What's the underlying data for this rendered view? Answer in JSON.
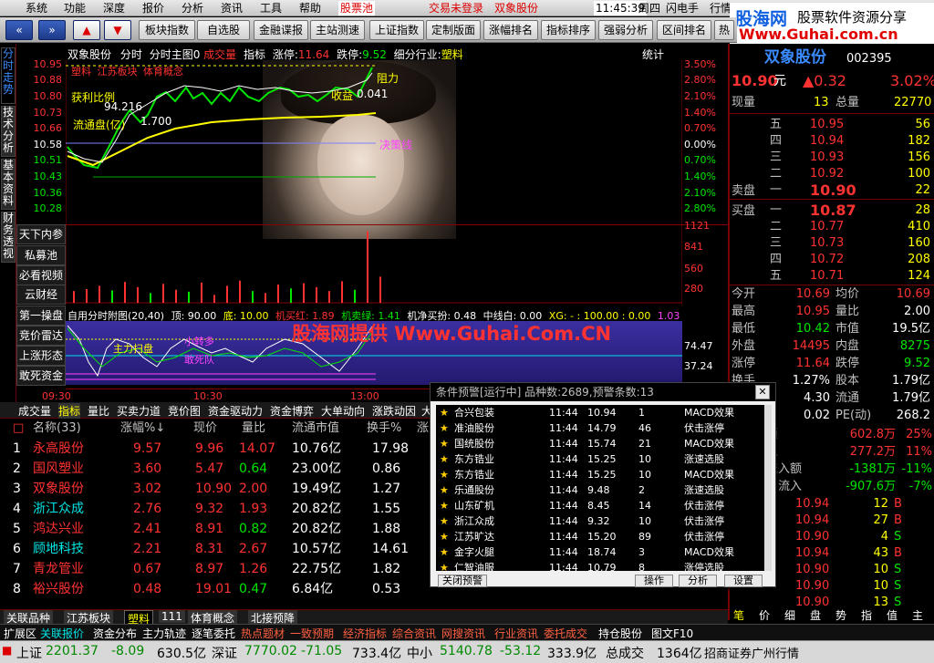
{
  "menu": {
    "items": [
      "系统",
      "功能",
      "深度",
      "报价",
      "分析",
      "资讯",
      "工具",
      "帮助",
      "股票池"
    ],
    "login_status": "交易未登录",
    "stock_name": "双象股份",
    "time": "11:45:39",
    "weekday": "周四",
    "flash": "闪电手",
    "hq": "行情"
  },
  "watermark_top": {
    "site": "股海网",
    "slogan": "股票软件资源分享",
    "url": "Www.Guhai.com.cn"
  },
  "toolbar": {
    "buttons": [
      "板块指数",
      "自选股",
      "金融谍报",
      "主站测速",
      "上证指数",
      "定制版面",
      "涨幅排名",
      "指标排序",
      "强弱分析",
      "区间排名",
      "热"
    ]
  },
  "vtabs": [
    "分时走势",
    "技术分析",
    "基本资料",
    "财务透视"
  ],
  "chart": {
    "header": {
      "stock": "双象股份",
      "mode": "分时",
      "main_label": "分时主图0",
      "main_tag": "成交量",
      "indicator": "指标",
      "stop_up_label": "涨停:",
      "stop_up": "11.64",
      "stop_down_label": "跌停:",
      "stop_down": "9.52",
      "industry_label": "细分行业:",
      "industry": "塑料",
      "stats": "统计"
    },
    "legend": [
      "塑料",
      "江苏板块",
      "体育概念"
    ],
    "annotations": {
      "profit_ratio": "获利比例",
      "profit_val": "94.216",
      "float_cap": "流通盘(亿)",
      "float_val": "1.700",
      "income": "收益",
      "income_val": "0.041",
      "resist": "阻力",
      "decision": "决策线"
    },
    "price_axis": [
      "10.95",
      "10.88",
      "10.80",
      "10.73",
      "10.66",
      "10.58",
      "10.51",
      "10.43",
      "10.36",
      "10.28"
    ],
    "pct_axis": [
      "3.50%",
      "2.80%",
      "2.10%",
      "1.40%",
      "0.70%",
      "0.00%",
      "0.70%",
      "1.40%",
      "2.10%",
      "2.80%"
    ],
    "vol_axis": [
      "1121",
      "841",
      "560",
      "280"
    ],
    "side_buttons": [
      "天下内参",
      "私募池",
      "必看视频",
      "云财经",
      "第一操盘",
      "竞价雷达",
      "上涨形态",
      "敢死资金"
    ],
    "sub_header": {
      "title": "自用分时附图(20,40)",
      "top": "顶: 90.00",
      "bottom": "底: 10.00",
      "red_label": "机买红: 1.89",
      "green_label": "机卖绿: 1.41",
      "net": "机净买扮: 0.48",
      "mid": "中线白: 0.00",
      "xg": "XG: - : 100.00 : 0.00",
      "tail": "1.03"
    },
    "sub_axis": [
      "74.47",
      "37.24"
    ],
    "sub_labels": {
      "main_force": "主力扫盘",
      "kong": "小转多",
      "dead": "敢死队"
    },
    "guhai_banner": "股海网提供 Www.Guhai.Com.CN",
    "time_axis": [
      "09:30",
      "10:30",
      "13:00"
    ],
    "volume_bars": [
      {
        "v": 180,
        "c": "r"
      },
      {
        "v": 210,
        "c": "r"
      },
      {
        "v": 260,
        "c": "r"
      },
      {
        "v": 190,
        "c": "g"
      },
      {
        "v": 320,
        "c": "r"
      },
      {
        "v": 240,
        "c": "r"
      },
      {
        "v": 150,
        "c": "g"
      },
      {
        "v": 290,
        "c": "r"
      },
      {
        "v": 200,
        "c": "r"
      },
      {
        "v": 170,
        "c": "g"
      },
      {
        "v": 310,
        "c": "r"
      },
      {
        "v": 120,
        "c": "r"
      },
      {
        "v": 260,
        "c": "r"
      },
      {
        "v": 340,
        "c": "r"
      },
      {
        "v": 180,
        "c": "g"
      },
      {
        "v": 150,
        "c": "r"
      },
      {
        "v": 280,
        "c": "r"
      },
      {
        "v": 220,
        "c": "g"
      },
      {
        "v": 300,
        "c": "r"
      },
      {
        "v": 240,
        "c": "r"
      },
      {
        "v": 180,
        "c": "r"
      },
      {
        "v": 330,
        "c": "r"
      },
      {
        "v": 200,
        "c": "g"
      },
      {
        "v": 1100,
        "c": "r"
      },
      {
        "v": 400,
        "c": "r"
      }
    ]
  },
  "bottom_tabs": [
    "成交量",
    "指标",
    "量比",
    "买卖力道",
    "竞价图",
    "资金驱动力",
    "资金博弈",
    "大单动向",
    "涨跌动因",
    "大"
  ],
  "table": {
    "headers": [
      "名称(33)",
      "涨幅%↓",
      "现价",
      "量比",
      "流通市值",
      "换手%",
      "涨"
    ],
    "rows": [
      {
        "idx": "1",
        "name": "永高股份",
        "pct": "9.57",
        "price": "9.96",
        "vr": "14.07",
        "cap": "10.76亿",
        "turn": "17.98",
        "c": "r",
        "nc": "r"
      },
      {
        "idx": "2",
        "name": "国风塑业",
        "pct": "3.60",
        "price": "5.47",
        "vr": "0.64",
        "cap": "23.00亿",
        "turn": "0.86",
        "c": "r",
        "nc": "r"
      },
      {
        "idx": "3",
        "name": "双象股份",
        "pct": "3.02",
        "price": "10.90",
        "vr": "2.00",
        "cap": "19.49亿",
        "turn": "1.27",
        "c": "r",
        "nc": "r"
      },
      {
        "idx": "4",
        "name": "浙江众成",
        "pct": "2.76",
        "price": "9.32",
        "vr": "1.93",
        "cap": "20.82亿",
        "turn": "1.55",
        "c": "r",
        "nc": "c"
      },
      {
        "idx": "5",
        "name": "鸿达兴业",
        "pct": "2.41",
        "price": "8.91",
        "vr": "0.82",
        "cap": "20.82亿",
        "turn": "1.88",
        "c": "r",
        "nc": "r"
      },
      {
        "idx": "6",
        "name": "顾地科技",
        "pct": "2.21",
        "price": "8.31",
        "vr": "2.67",
        "cap": "10.57亿",
        "turn": "14.61",
        "c": "r",
        "nc": "c"
      },
      {
        "idx": "7",
        "name": "青龙管业",
        "pct": "0.67",
        "price": "8.97",
        "vr": "1.26",
        "cap": "22.75亿",
        "turn": "1.82",
        "c": "r",
        "nc": "r"
      },
      {
        "idx": "8",
        "name": "裕兴股份",
        "pct": "0.48",
        "price": "19.01",
        "vr": "0.47",
        "cap": "6.84亿",
        "turn": "0.53",
        "c": "r",
        "nc": "r"
      }
    ]
  },
  "block_tabs": [
    "关联品种",
    "江苏板块",
    "塑料",
    "111",
    "体育概念",
    "北接预降"
  ],
  "func_bar": [
    "扩展区",
    "关联报价",
    "资金分布",
    "主力轨迹",
    "逐笔委托",
    "热点题材",
    "一致预期",
    "经济指标",
    "综合资讯",
    "网搜资讯",
    "行业资讯",
    "委托成交",
    "持仓股份",
    "图文F10"
  ],
  "right_panel": {
    "title": "双象股份",
    "code": "002395",
    "price": "10.90",
    "unit": "元",
    "change": "▲0.32",
    "pct": "3.02%",
    "now_label": "现量",
    "now_val": "13",
    "total_label": "总量",
    "total_val": "22770",
    "sells": [
      {
        "l": "五",
        "p": "10.95",
        "v": "56"
      },
      {
        "l": "四",
        "p": "10.94",
        "v": "182"
      },
      {
        "l": "三",
        "p": "10.93",
        "v": "156"
      },
      {
        "l": "二",
        "p": "10.92",
        "v": "100"
      },
      {
        "l": "一",
        "p": "10.90",
        "v": "22"
      }
    ],
    "sell_label": "卖盘",
    "buy_label": "买盘",
    "buys": [
      {
        "l": "一",
        "p": "10.87",
        "v": "28"
      },
      {
        "l": "二",
        "p": "10.77",
        "v": "410"
      },
      {
        "l": "三",
        "p": "10.73",
        "v": "160"
      },
      {
        "l": "四",
        "p": "10.72",
        "v": "208"
      },
      {
        "l": "五",
        "p": "10.71",
        "v": "124"
      }
    ],
    "stats": [
      {
        "a": "今开",
        "av": "10.69",
        "b": "均价",
        "bv": "10.69"
      },
      {
        "a": "最高",
        "av": "10.95",
        "b": "量比",
        "bv": "2.00"
      },
      {
        "a": "最低",
        "av": "10.42",
        "b": "市值",
        "bv": "19.5亿"
      },
      {
        "a": "外盘",
        "av": "14495",
        "b": "内盘",
        "bv": "8275"
      },
      {
        "a": "涨停",
        "av": "11.64",
        "b": "跌停",
        "bv": "9.52"
      },
      {
        "a": "换手",
        "av": "1.27%",
        "b": "股本",
        "bv": "1.79亿"
      },
      {
        "a": "净资",
        "av": "4.30",
        "b": "流通",
        "bv": "1.79亿"
      },
      {
        "a": "收益",
        "av": "0.02",
        "b": "PE(动)",
        "bv": "268.2"
      }
    ],
    "flows": [
      {
        "l": "额",
        "v": "602.8万",
        "p": "25%"
      },
      {
        "l": "入",
        "v": "277.2万",
        "p": "11%"
      },
      {
        "l": "流入额",
        "v": "-1381万",
        "p": "-11%"
      },
      {
        "l": "户流入",
        "v": "-907.6万",
        "p": "-7%"
      }
    ],
    "ticks": [
      {
        "p": "10.94",
        "v": "12",
        "d": "B"
      },
      {
        "p": "10.94",
        "v": "27",
        "d": "B"
      },
      {
        "p": "10.90",
        "v": "4",
        "d": "S"
      },
      {
        "p": "10.94",
        "v": "43",
        "d": "B"
      },
      {
        "p": "10.90",
        "v": "10",
        "d": "S"
      },
      {
        "p": "10.90",
        "v": "10",
        "d": "S"
      },
      {
        "p": "10.90",
        "v": "13",
        "d": "S"
      }
    ],
    "bottom_tabs": [
      "笔",
      "价",
      "细",
      "盘",
      "势",
      "指",
      "值",
      "主"
    ]
  },
  "popup": {
    "title": "条件预警[运行中] 品种数:2689,预警条数:13",
    "rows": [
      {
        "name": "合兴包装",
        "time": "11:44",
        "price": "10.94",
        "v": "1",
        "sig": "MACD效果"
      },
      {
        "name": "准油股份",
        "time": "11:44",
        "price": "14.79",
        "v": "46",
        "sig": "伏击涨停"
      },
      {
        "name": "国统股份",
        "time": "11:44",
        "price": "15.74",
        "v": "21",
        "sig": "MACD效果"
      },
      {
        "name": "东方锆业",
        "time": "11:44",
        "price": "15.25",
        "v": "10",
        "sig": "涨速选股"
      },
      {
        "name": "东方锆业",
        "time": "11:44",
        "price": "15.25",
        "v": "10",
        "sig": "MACD效果"
      },
      {
        "name": "乐通股份",
        "time": "11:44",
        "price": "9.48",
        "v": "2",
        "sig": "涨速选股"
      },
      {
        "name": "山东矿机",
        "time": "11:44",
        "price": "8.45",
        "v": "14",
        "sig": "伏击涨停"
      },
      {
        "name": "浙江众成",
        "time": "11:44",
        "price": "9.32",
        "v": "10",
        "sig": "伏击涨停"
      },
      {
        "name": "江苏旷达",
        "time": "11:44",
        "price": "15.20",
        "v": "89",
        "sig": "伏击涨停"
      },
      {
        "name": "金字火腿",
        "time": "11:44",
        "price": "18.74",
        "v": "3",
        "sig": "MACD效果"
      },
      {
        "name": "仁智油服",
        "time": "11:44",
        "price": "10.79",
        "v": "8",
        "sig": "涨停选股"
      }
    ],
    "buttons": [
      "关闭预警",
      "操作",
      "分析",
      "设置"
    ]
  },
  "status": {
    "sh_label": "上证",
    "sh": "2201.37",
    "sh_chg": "-8.09",
    "sh_amt": "630.5亿",
    "sz_label": "深证",
    "sz": "7770.02",
    "sz_chg": "-71.05",
    "sz_amt": "733.4亿",
    "zx_label": "中小",
    "zx": "5140.78",
    "zx_chg": "-53.12",
    "zx_amt": "333.9亿",
    "total_label": "总成交",
    "total": "1364亿",
    "broker": "招商证券广州行情"
  },
  "colors": {
    "up": "#ff3232",
    "down": "#00e600",
    "accent": "#ffff00",
    "bg": "#000000"
  }
}
